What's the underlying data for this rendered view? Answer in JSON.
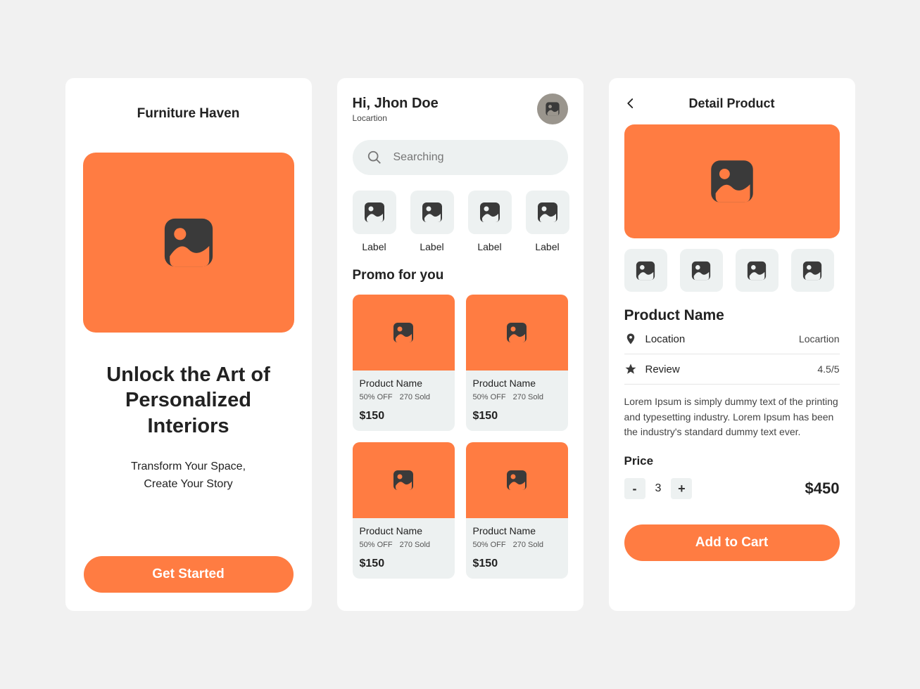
{
  "onboard": {
    "brand": "Furniture Haven",
    "headline": "Unlock the Art of Personalized Interiors",
    "sub1": "Transform Your Space,",
    "sub2": "Create Your Story",
    "cta": "Get Started"
  },
  "home": {
    "greeting": "Hi, Jhon Doe",
    "location": "Locartion",
    "search_placeholder": "Searching",
    "categories": [
      {
        "label": "Label"
      },
      {
        "label": "Label"
      },
      {
        "label": "Label"
      },
      {
        "label": "Label"
      }
    ],
    "section_title": "Promo for you",
    "products": [
      {
        "name": "Product Name",
        "discount": "50% OFF",
        "sold": "270 Sold",
        "price": "$150"
      },
      {
        "name": "Product Name",
        "discount": "50% OFF",
        "sold": "270 Sold",
        "price": "$150"
      },
      {
        "name": "Product Name",
        "discount": "50% OFF",
        "sold": "270 Sold",
        "price": "$150"
      },
      {
        "name": "Product Name",
        "discount": "50% OFF",
        "sold": "270 Sold",
        "price": "$150"
      }
    ]
  },
  "detail": {
    "title": "Detail Product",
    "name": "Product Name",
    "location_label": "Location",
    "location_value": "Locartion",
    "review_label": "Review",
    "review_value": "4.5/5",
    "description": "Lorem Ipsum is simply dummy text of the printing and typesetting industry. Lorem Ipsum has been the industry's standard dummy text ever.",
    "price_label": "Price",
    "qty": "3",
    "price": "$450",
    "cta": "Add to Cart"
  }
}
